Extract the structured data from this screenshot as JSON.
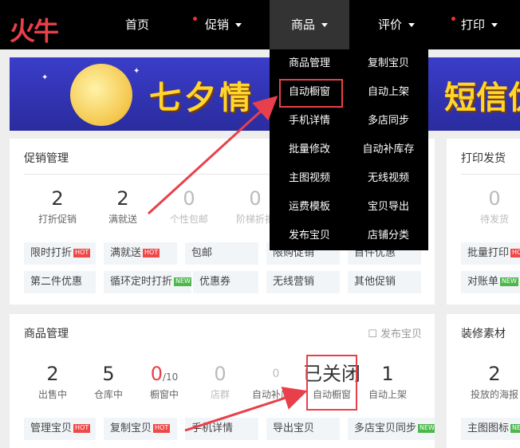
{
  "logo": "火牛",
  "nav": [
    {
      "label": "首页"
    },
    {
      "label": "促销"
    },
    {
      "label": "商品"
    },
    {
      "label": "评价"
    },
    {
      "label": "打印"
    }
  ],
  "dropdown": [
    "商品管理",
    "复制宝贝",
    "自动橱窗",
    "自动上架",
    "手机详情",
    "多店同步",
    "批量修改",
    "自动补库存",
    "主图视频",
    "无线视频",
    "运费模板",
    "宝贝导出",
    "发布宝贝",
    "店铺分类"
  ],
  "banner": {
    "text": "七夕情",
    "text_right": "短信优惠"
  },
  "promo": {
    "title": "促销管理",
    "stats": [
      {
        "num": "2",
        "label": "打折促销"
      },
      {
        "num": "2",
        "label": "满就送"
      },
      {
        "num": "0",
        "label": "个性包邮"
      },
      {
        "num": "0",
        "label": "阶梯折扣"
      }
    ],
    "chips": [
      {
        "label": "限时打折",
        "tag": "HOT"
      },
      {
        "label": "满就送",
        "tag": "HOT"
      },
      {
        "label": "包邮",
        "tag": ""
      },
      {
        "label": "限购促销",
        "tag": ""
      },
      {
        "label": "首件优惠",
        "tag": ""
      },
      {
        "label": "第二件优惠",
        "tag": ""
      },
      {
        "label": "循环定时打折",
        "tag": "NEW"
      },
      {
        "label": "优惠券",
        "tag": ""
      },
      {
        "label": "无线营销",
        "tag": ""
      },
      {
        "label": "其他促销",
        "tag": ""
      }
    ]
  },
  "print": {
    "title": "打印发货",
    "stats": [
      {
        "num": "0",
        "label": "待发货"
      }
    ],
    "chips": [
      {
        "label": "批量打印",
        "tag": "HOT"
      },
      {
        "label": "对账单",
        "tag": "NEW"
      }
    ]
  },
  "goods": {
    "title": "商品管理",
    "publish": "发布宝贝",
    "stats": [
      {
        "num": "2",
        "label": "出售中"
      },
      {
        "num": "5",
        "label": "仓库中"
      },
      {
        "num": "0",
        "suffix": "/10",
        "label": "橱窗中"
      },
      {
        "num": "0",
        "label": "店群"
      },
      {
        "num": "0",
        "label": "自动补库存"
      },
      {
        "num": "已关闭",
        "label": "自动橱窗"
      },
      {
        "num": "1",
        "label": "自动上架"
      }
    ],
    "chips": [
      {
        "label": "管理宝贝",
        "tag": "HOT"
      },
      {
        "label": "复制宝贝",
        "tag": "HOT"
      },
      {
        "label": "手机详情",
        "tag": ""
      },
      {
        "label": "导出宝贝",
        "tag": ""
      },
      {
        "label": "多店宝贝同步",
        "tag": "NEW"
      }
    ]
  },
  "decor": {
    "title": "装修素材",
    "stats": [
      {
        "num": "2",
        "label": "投放的海报"
      }
    ],
    "chips": [
      {
        "label": "主图图标",
        "tag": "NEW"
      }
    ]
  }
}
